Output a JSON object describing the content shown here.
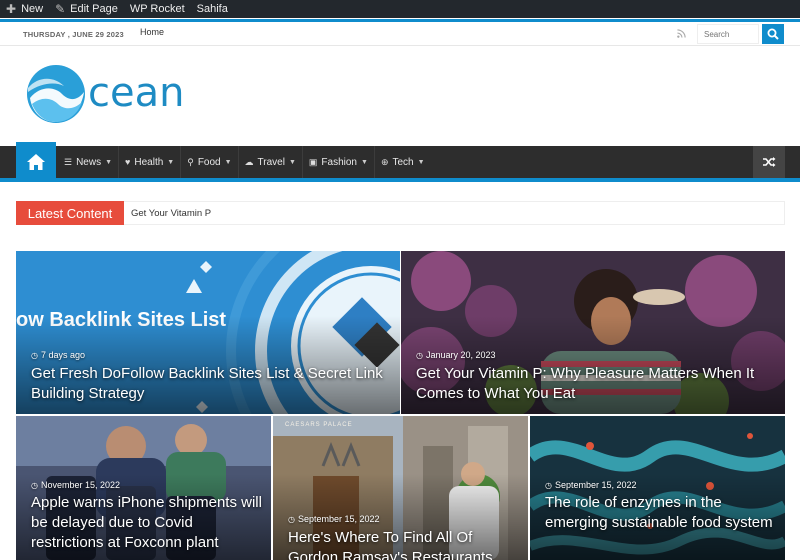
{
  "adminbar": {
    "new": "New",
    "edit_page": "Edit Page",
    "wp_rocket": "WP Rocket",
    "sahifa": "Sahifa"
  },
  "topbar": {
    "date": "THURSDAY , JUNE 29 2023",
    "nav_home": "Home",
    "search_placeholder": "Search"
  },
  "logo": {
    "word": "cean"
  },
  "mainnav": {
    "items": [
      {
        "label": "News",
        "icon": "list-icon"
      },
      {
        "label": "Health",
        "icon": "heart-icon"
      },
      {
        "label": "Food",
        "icon": "food-icon"
      },
      {
        "label": "Travel",
        "icon": "cloud-icon"
      },
      {
        "label": "Fashion",
        "icon": "briefcase-icon"
      },
      {
        "label": "Tech",
        "icon": "globe-icon"
      }
    ]
  },
  "ticker": {
    "label": "Latest Content",
    "text": "Get Your Vitamin P"
  },
  "posts": [
    {
      "date": "7 days ago",
      "title": "Get Fresh DoFollow Backlink Sites List & Secret Link Building Strategy",
      "banner": "ow Backlink Sites List"
    },
    {
      "date": "January 20, 2023",
      "title": "Get Your Vitamin P: Why Pleasure Matters When It Comes to What You Eat"
    },
    {
      "date": "November 15, 2022",
      "title": "Apple warns iPhone shipments will be delayed due to Covid restrictions at Foxconn plant"
    },
    {
      "date": "September 15, 2022",
      "title": "Here's Where To Find All Of Gordon Ramsay's Restaurants",
      "sign": "CAESARS PALACE"
    },
    {
      "date": "September 15, 2022",
      "title": "The role of enzymes in the emerging sustainable food system"
    }
  ],
  "colors": {
    "accent": "#0f8ccc",
    "ticker_label": "#e74c3c",
    "nav_bg": "#2d2d2d"
  }
}
